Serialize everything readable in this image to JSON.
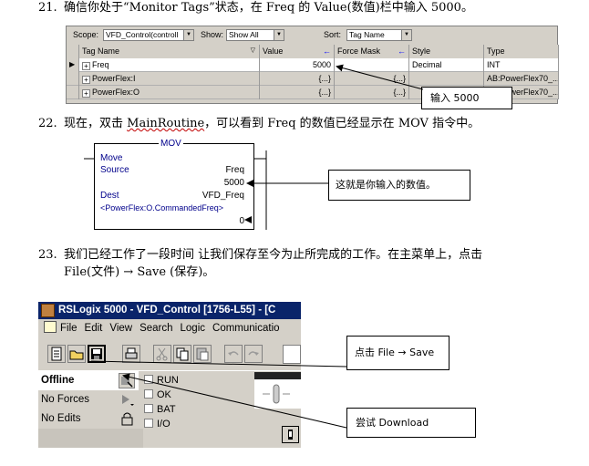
{
  "steps": {
    "s21": {
      "num": "21.",
      "text": "确信你处于“Monitor Tags”状态，在 Freq 的 Value(数值)栏中输入 5000。"
    },
    "s22": {
      "num": "22.",
      "text_before": "现在，双击 ",
      "link": "MainRoutine",
      "text_after": "，可以看到 Freq 的数值已经显示在 MOV 指令中。"
    },
    "s23": {
      "num": "23.",
      "line1": "我们已经工作了一段时间 让我们保存至今为止所完成的工作。在主菜单上，点击",
      "line2": "File(文件) → Save (保存)。"
    }
  },
  "tag_grid": {
    "scope_label": "Scope:",
    "scope_value": "VFD_Control(controll",
    "show_label": "Show:",
    "show_value": "Show All",
    "sort_label": "Sort:",
    "sort_value": "Tag Name",
    "columns": [
      "Tag Name",
      "Value",
      "Force Mask",
      "Style",
      "Type"
    ],
    "rows": [
      {
        "name": "Freq",
        "value": "5000",
        "force": "",
        "style": "Decimal",
        "type": "INT"
      },
      {
        "name": "PowerFlex:I",
        "value": "{...}",
        "force": "{...}",
        "style": "",
        "type": "AB:PowerFlex70_..."
      },
      {
        "name": "PowerFlex:O",
        "value": "{...}",
        "force": "{...}",
        "style": "",
        "type": "AB:PowerFlex70_..."
      }
    ]
  },
  "callouts": {
    "enter_value": "输入 5000",
    "this_is_value": "这就是你输入的数值。",
    "click_save": "点击 File → Save",
    "try_download": "尝试 Download"
  },
  "mov": {
    "title": "MOV",
    "name": "Move",
    "source_label": "Source",
    "source_tag": "Freq",
    "source_value": "5000",
    "dest_label": "Dest",
    "dest_tag": "VFD_Freq",
    "dest_desc": "<PowerFlex:O.CommandedFreq>",
    "dest_value": "0"
  },
  "rslogix": {
    "title": "RSLogix 5000 - VFD_Control [1756-L55] - [C",
    "menu": [
      "File",
      "Edit",
      "View",
      "Search",
      "Logic",
      "Communicatio"
    ],
    "status": [
      "Offline",
      "No Forces",
      "No Edits"
    ],
    "leds": [
      "RUN",
      "OK",
      "BAT",
      "I/O"
    ]
  }
}
